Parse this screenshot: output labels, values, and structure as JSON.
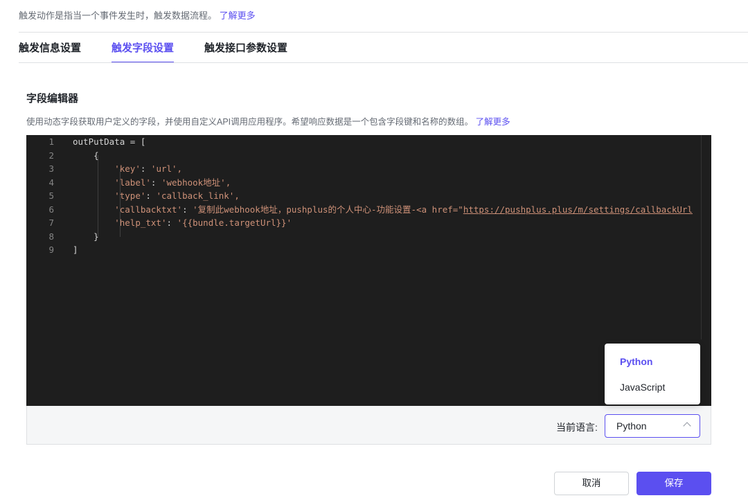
{
  "intro": {
    "text": "触发动作是指当一个事件发生时，触发数据流程。",
    "link": "了解更多"
  },
  "tabs": [
    {
      "label": "触发信息设置"
    },
    {
      "label": "触发字段设置"
    },
    {
      "label": "触发接口参数设置"
    }
  ],
  "section": {
    "title": "字段编辑器",
    "desc": "使用动态字段获取用户定义的字段，并使用自定义API调用应用程序。希望响应数据是一个包含字段键和名称的数组。",
    "link": "了解更多"
  },
  "editor": {
    "lines": [
      {
        "n": "1",
        "a": "outPutData = [",
        "b": "",
        "c": "",
        "d": ""
      },
      {
        "n": "2",
        "a": "    {",
        "b": "",
        "c": "",
        "d": ""
      },
      {
        "n": "3",
        "a": "        ",
        "b": "'key'",
        "c": ": ",
        "d": "'url',"
      },
      {
        "n": "4",
        "a": "        ",
        "b": "'label'",
        "c": ": ",
        "d": "'webhook地址',"
      },
      {
        "n": "5",
        "a": "        ",
        "b": "'type'",
        "c": ": ",
        "d": "'callback_link',"
      },
      {
        "n": "6",
        "a": "        ",
        "b": "'callbacktxt'",
        "c": ": ",
        "d": "'复制此webhook地址，pushplus的个人中心-功能设置-<a href=\""
      },
      {
        "n": "7",
        "a": "        ",
        "b": "'help_txt'",
        "c": ": ",
        "d": "'{{bundle.targetUrl}}'"
      },
      {
        "n": "8",
        "a": "    }",
        "b": "",
        "c": "",
        "d": ""
      },
      {
        "n": "9",
        "a": "]",
        "b": "",
        "c": "",
        "d": ""
      }
    ],
    "link_text": "https://pushplus.plus/m/settings/callbackUrl"
  },
  "language": {
    "label": "当前语言:",
    "selected": "Python",
    "options": [
      "Python",
      "JavaScript"
    ]
  },
  "buttons": {
    "cancel": "取消",
    "save": "保存"
  }
}
